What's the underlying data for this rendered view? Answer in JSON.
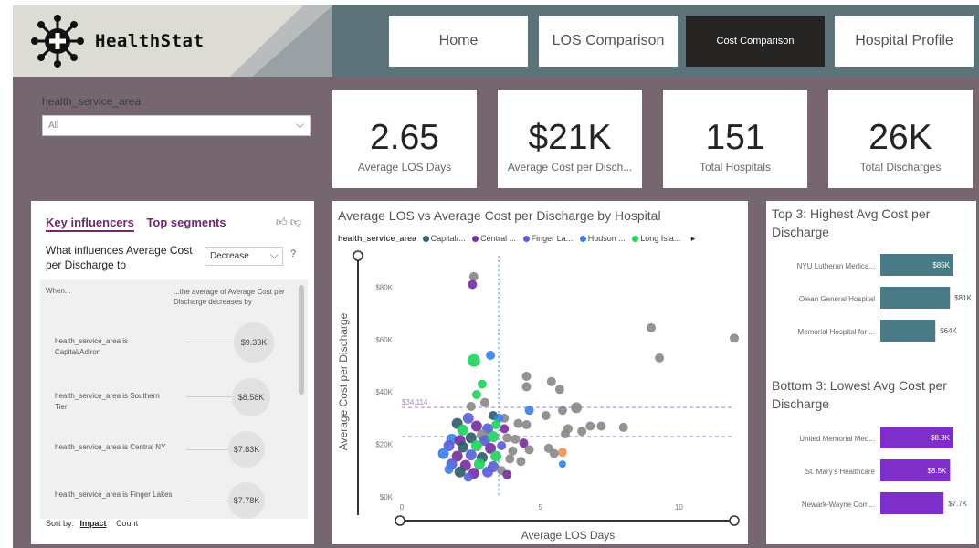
{
  "app": {
    "name": "HealthStat"
  },
  "nav": [
    {
      "label": "Home",
      "active": false
    },
    {
      "label": "LOS Comparison",
      "active": false
    },
    {
      "label": "Cost Comparison",
      "active": true
    },
    {
      "label": "Hospital Profile",
      "active": false
    }
  ],
  "slicer": {
    "label": "health_service_area",
    "value": "All"
  },
  "kpis": [
    {
      "value": "2.65",
      "label": "Average LOS Days"
    },
    {
      "value": "$21K",
      "label": "Average Cost per Disch..."
    },
    {
      "value": "151",
      "label": "Total Hospitals"
    },
    {
      "value": "26K",
      "label": "Total Discharges"
    }
  ],
  "key_influencers": {
    "tab_active": "Key influencers",
    "tab_other": "Top segments",
    "question": "What influences Average Cost per Discharge to",
    "direction": "Decrease",
    "help": "?",
    "when": "When...",
    "then": "...the average of Average Cost per Discharge decreases by",
    "sort_label": "Sort by:",
    "sort_selected": "Impact",
    "sort_other": "Count",
    "rows": [
      {
        "label": "health_service_area is Capital/Adiron",
        "value": "$9.33K"
      },
      {
        "label": "health_service_area is Southern Tier",
        "value": "$8.58K"
      },
      {
        "label": "health_service_area is Central NY",
        "value": "$7.83K"
      },
      {
        "label": "health_service_area is Finger Lakes",
        "value": "$7.78K"
      }
    ]
  },
  "scatter": {
    "title": "Average LOS vs Average Cost per Discharge by Hospital",
    "legend_title": "health_service_area",
    "legend": [
      {
        "name": "Capital/...",
        "color": "#2f5f6b"
      },
      {
        "name": "Central ...",
        "color": "#7b2fa4"
      },
      {
        "name": "Finger La...",
        "color": "#5b5fd6"
      },
      {
        "name": "Hudson ...",
        "color": "#3b82e8"
      },
      {
        "name": "Long Isla...",
        "color": "#22d35e"
      }
    ],
    "more_icon": "▸"
  },
  "top3": {
    "title": "Top 3: Highest Avg Cost per Discharge",
    "items": [
      {
        "label": "NYU Lutheran Medica...",
        "value": "$85K",
        "value_inside": true
      },
      {
        "label": "Olean General Hospital",
        "value": "$81K",
        "value_inside": false
      },
      {
        "label": "Memorial Hospital for ...",
        "value": "$64K",
        "value_inside": false
      }
    ]
  },
  "bottom3": {
    "title": "Bottom 3: Lowest Avg Cost per Discharge",
    "items": [
      {
        "label": "United Memorial Med...",
        "value": "$8.9K",
        "value_inside": true
      },
      {
        "label": "St. Mary's Healthcare",
        "value": "$8.5K",
        "value_inside": true
      },
      {
        "label": "Newark-Wayne Com...",
        "value": "$7.7K",
        "value_inside": false
      }
    ]
  },
  "colors": {
    "page_bg": "#76666f",
    "header_bg": "#5c7479",
    "top_bar": "#4a7a86",
    "bottom_bar": "#7f2fc9",
    "accent": "#742774",
    "ref_line": "#b58ad6"
  },
  "chart_data": {
    "type": "scatter",
    "title": "Average LOS vs Average Cost per Discharge by Hospital",
    "xlabel": "Average LOS Days",
    "ylabel": "Average Cost per Discharge",
    "xlim": [
      0,
      12
    ],
    "ylim": [
      0,
      85000
    ],
    "xticks": [
      0,
      5,
      10
    ],
    "xtick_labels": [
      "0",
      "5",
      "10"
    ],
    "yticks": [
      0,
      20000,
      40000,
      60000,
      80000
    ],
    "ytick_labels": [
      "$0K",
      "$20K",
      "$40K",
      "$60K",
      "$80K"
    ],
    "ref_lines": [
      {
        "axis": "y",
        "value": 34114,
        "label": "$34,114"
      },
      {
        "axis": "y",
        "value": 23000,
        "label": ""
      },
      {
        "axis": "x",
        "value": 3.5,
        "label": ""
      }
    ],
    "points": [
      [
        2.6,
        84000,
        "#8a8a8a",
        5
      ],
      [
        2.55,
        81000,
        "#7b2fa4",
        5
      ],
      [
        9.0,
        64500,
        "#8a8a8a",
        5
      ],
      [
        9.3,
        53000,
        "#8a8a8a",
        5
      ],
      [
        12.0,
        60500,
        "#8a8a8a",
        5
      ],
      [
        2.6,
        52000,
        "#22d35e",
        7
      ],
      [
        3.2,
        54000,
        "#3b82e8",
        5
      ],
      [
        2.9,
        43000,
        "#22d35e",
        5
      ],
      [
        4.5,
        46000,
        "#8a8a8a",
        5
      ],
      [
        4.5,
        42000,
        "#8a8a8a",
        5
      ],
      [
        5.4,
        44000,
        "#8a8a8a",
        5
      ],
      [
        5.7,
        41000,
        "#8a8a8a",
        5
      ],
      [
        2.7,
        39000,
        "#22d35e",
        5
      ],
      [
        3.0,
        36000,
        "#8a8a8a",
        5
      ],
      [
        2.5,
        34500,
        "#8a8a8a",
        5
      ],
      [
        4.6,
        33000,
        "#3b82e8",
        5
      ],
      [
        5.8,
        33000,
        "#8a8a8a",
        5
      ],
      [
        6.3,
        34000,
        "#8a8a8a",
        6
      ],
      [
        5.2,
        31000,
        "#8a8a8a",
        5
      ],
      [
        3.7,
        30000,
        "#8a8a8a",
        5
      ],
      [
        4.2,
        28000,
        "#8a8a8a",
        5
      ],
      [
        4.5,
        27500,
        "#8a8a8a",
        5
      ],
      [
        6.0,
        26000,
        "#8a8a8a",
        5
      ],
      [
        6.8,
        27000,
        "#8a8a8a",
        5
      ],
      [
        7.2,
        27000,
        "#8a8a8a",
        5
      ],
      [
        8.0,
        26500,
        "#8a8a8a",
        5
      ],
      [
        5.9,
        24000,
        "#8a8a8a",
        5
      ],
      [
        6.5,
        25000,
        "#8a8a8a",
        5
      ],
      [
        3.3,
        31000,
        "#2f5f6b",
        5
      ],
      [
        3.5,
        30000,
        "#3b82e8",
        5
      ],
      [
        2.4,
        30000,
        "#5b5fd6",
        6
      ],
      [
        2.0,
        28000,
        "#2f5f6b",
        6
      ],
      [
        2.2,
        25500,
        "#22d35e",
        6
      ],
      [
        2.7,
        27000,
        "#7b2fa4",
        6
      ],
      [
        3.1,
        26000,
        "#5b5fd6",
        6
      ],
      [
        3.4,
        27500,
        "#22d35e",
        5
      ],
      [
        3.7,
        26000,
        "#7b2fa4",
        5
      ],
      [
        2.9,
        23500,
        "#8a8a8a",
        6
      ],
      [
        1.8,
        22000,
        "#3b82e8",
        6
      ],
      [
        2.1,
        21500,
        "#7b2fa4",
        6
      ],
      [
        2.5,
        22500,
        "#2f5f6b",
        6
      ],
      [
        3.0,
        21500,
        "#5b5fd6",
        6
      ],
      [
        3.3,
        23000,
        "#22d35e",
        6
      ],
      [
        3.8,
        22500,
        "#8a8a8a",
        5
      ],
      [
        4.1,
        22000,
        "#8a8a8a",
        5
      ],
      [
        4.4,
        20500,
        "#7b2fa4",
        5
      ],
      [
        1.7,
        19500,
        "#5b5fd6",
        6
      ],
      [
        2.2,
        19000,
        "#2f5f6b",
        6
      ],
      [
        2.7,
        19500,
        "#22d35e",
        6
      ],
      [
        3.2,
        18500,
        "#7b2fa4",
        6
      ],
      [
        3.6,
        19500,
        "#5b5fd6",
        5
      ],
      [
        4.0,
        17500,
        "#8a8a8a",
        5
      ],
      [
        4.6,
        18000,
        "#8a8a8a",
        5
      ],
      [
        5.3,
        18500,
        "#8a8a8a",
        5
      ],
      [
        5.8,
        17000,
        "#f0935a",
        5
      ],
      [
        5.5,
        16500,
        "#8a8a8a",
        5
      ],
      [
        1.5,
        16500,
        "#3b82e8",
        6
      ],
      [
        2.0,
        15500,
        "#7b2fa4",
        6
      ],
      [
        2.5,
        16000,
        "#5b5fd6",
        6
      ],
      [
        2.9,
        15000,
        "#2f5f6b",
        6
      ],
      [
        3.4,
        15500,
        "#22d35e",
        6
      ],
      [
        3.9,
        14500,
        "#8a8a8a",
        5
      ],
      [
        1.8,
        12500,
        "#5b5fd6",
        6
      ],
      [
        2.3,
        12000,
        "#7b2fa4",
        6
      ],
      [
        2.8,
        12500,
        "#22d35e",
        6
      ],
      [
        3.3,
        11500,
        "#5b5fd6",
        6
      ],
      [
        2.1,
        9500,
        "#2f5f6b",
        6
      ],
      [
        2.6,
        9000,
        "#7b2fa4",
        6
      ],
      [
        3.1,
        9500,
        "#5b5fd6",
        6
      ],
      [
        3.6,
        10000,
        "#8a8a8a",
        5
      ],
      [
        1.7,
        10500,
        "#3b82e8",
        5
      ],
      [
        5.8,
        12500,
        "#3b82e8",
        4
      ],
      [
        3.8,
        8500,
        "#7b2fa4",
        5
      ],
      [
        4.3,
        13500,
        "#8a8a8a",
        5
      ],
      [
        2.4,
        7500,
        "#5b5fd6",
        5
      ]
    ]
  }
}
